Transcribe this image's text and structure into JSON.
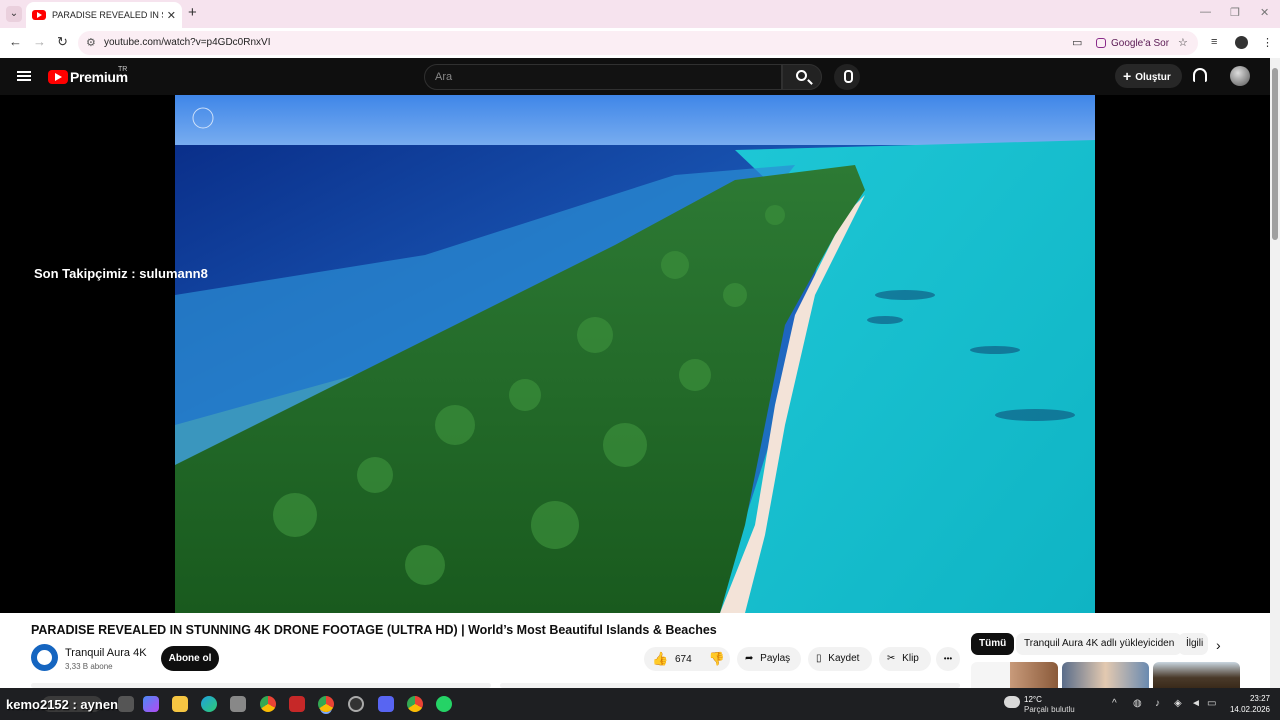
{
  "browser": {
    "tab_title": "PARADISE REVEALED IN STUNN",
    "url": "youtube.com/watch?v=p4GDc0RnxVI",
    "google_ask": "Google'a Sor"
  },
  "youtube": {
    "logo_text": "Premium",
    "region": "TR",
    "search_placeholder": "Ara",
    "create_label": "Oluştur"
  },
  "player": {
    "overlay_text": "Son Takipçimiz : sulumann8"
  },
  "video": {
    "title": "PARADISE REVEALED IN STUNNING 4K DRONE FOOTAGE (ULTRA HD) | World’s Most Beautiful Islands & Beaches",
    "channel_name": "Tranquil Aura 4K",
    "subscribers": "3,33 B abone",
    "subscribe_label": "Abone ol",
    "likes": "674",
    "share_label": "Paylaş",
    "save_label": "Kaydet",
    "clip_label": "Klip",
    "more_label": "•••"
  },
  "recommendations": {
    "chips": [
      "Tümü",
      "Tranquil Aura 4K adlı yükleyiciden",
      "İlgili"
    ]
  },
  "taskbar": {
    "overlay_text": "kemo2152 : aynen",
    "temperature": "12°C",
    "weather_desc": "Parçalı bulutlu",
    "time": "23:27",
    "date": "14.02.2026"
  },
  "colors": {
    "youtube_red": "#ff0000",
    "tab_strip": "#f6e3ee",
    "header_dark": "#0f0f0f"
  }
}
